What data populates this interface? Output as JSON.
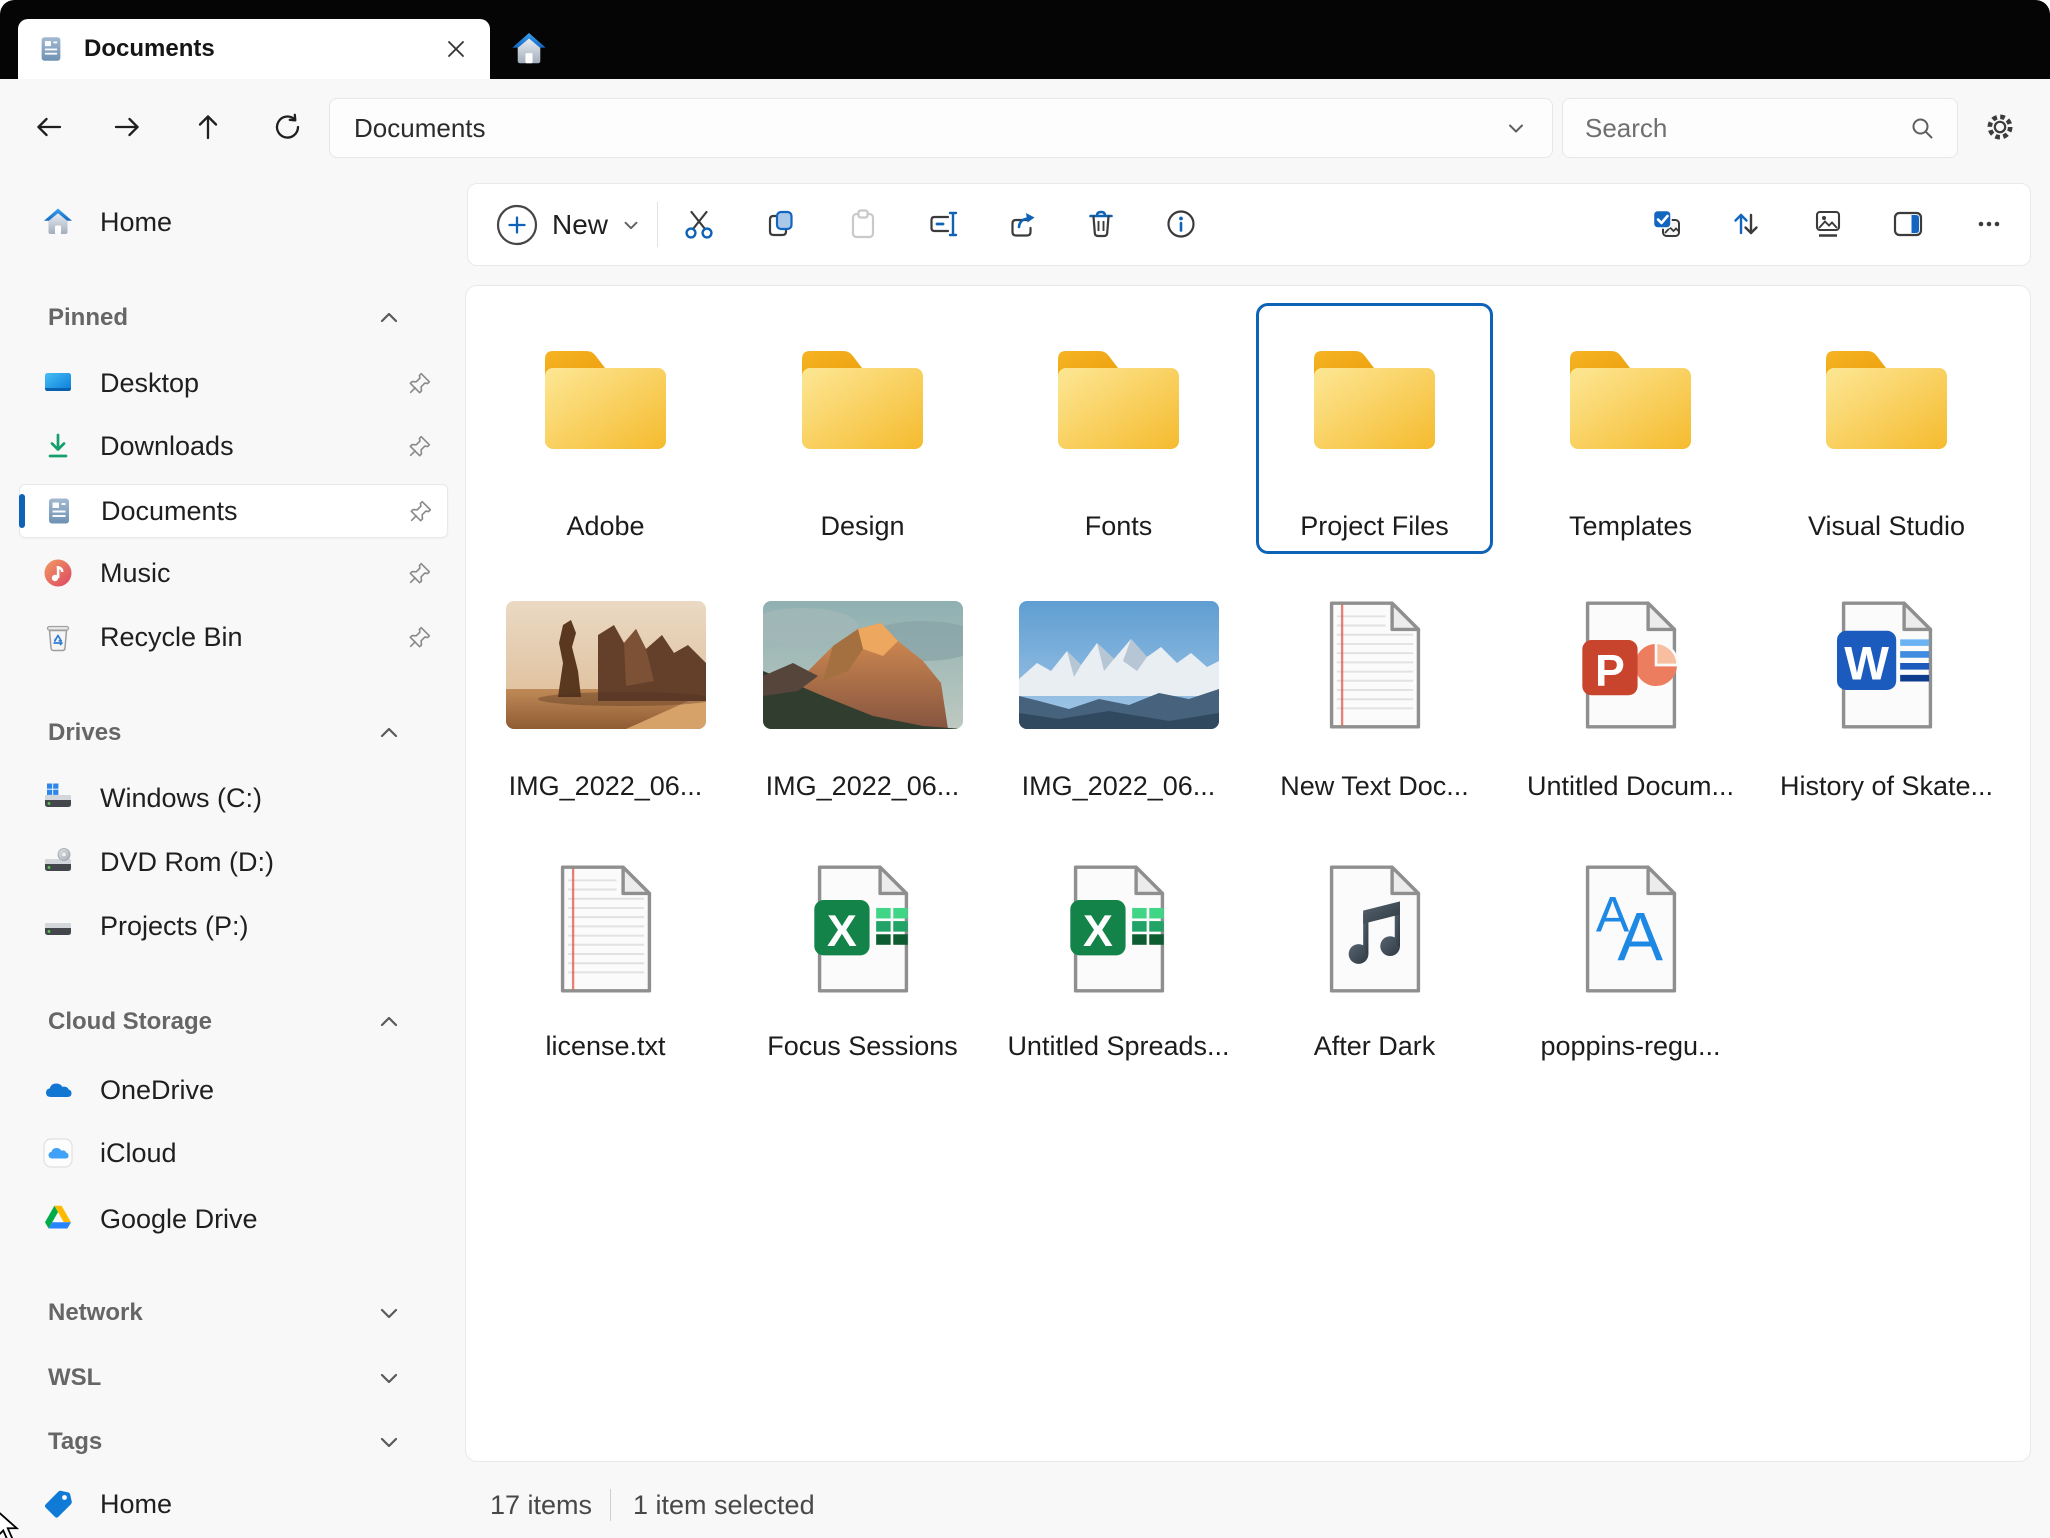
{
  "window": {
    "accent_color": "#0f63b6",
    "titlebar_color": "#050505",
    "background": "#f8f8f8"
  },
  "titlebar": {
    "tab_title": "Documents"
  },
  "toolbar": {
    "address_value": "Documents",
    "search_placeholder": "Search"
  },
  "command_bar": {
    "new_label": "New",
    "left_icons": [
      "cut",
      "copy",
      "paste",
      "rename",
      "share",
      "delete",
      "info"
    ],
    "right_icons": [
      "select-multiple",
      "sort",
      "view-thumbnails",
      "details-pane",
      "more"
    ]
  },
  "sidebar": {
    "home_label": "Home",
    "sections": [
      {
        "label": "Pinned",
        "state": "expanded",
        "items": [
          {
            "label": "Desktop",
            "icon": "desktop-icon",
            "pinned": true
          },
          {
            "label": "Downloads",
            "icon": "downloads-icon",
            "pinned": true
          },
          {
            "label": "Documents",
            "icon": "document-icon",
            "pinned": true,
            "selected": true
          },
          {
            "label": "Music",
            "icon": "music-icon",
            "pinned": true
          },
          {
            "label": "Recycle Bin",
            "icon": "recycle-bin-icon",
            "pinned": true
          }
        ]
      },
      {
        "label": "Drives",
        "state": "expanded",
        "items": [
          {
            "label": "Windows (C:)",
            "icon": "windows-drive-icon"
          },
          {
            "label": "DVD Rom (D:)",
            "icon": "dvd-drive-icon"
          },
          {
            "label": "Projects (P:)",
            "icon": "drive-icon"
          }
        ]
      },
      {
        "label": "Cloud Storage",
        "state": "expanded",
        "items": [
          {
            "label": "OneDrive",
            "icon": "onedrive-icon"
          },
          {
            "label": "iCloud",
            "icon": "icloud-icon"
          },
          {
            "label": "Google Drive",
            "icon": "google-drive-icon"
          }
        ]
      },
      {
        "label": "Network",
        "state": "collapsed",
        "items": []
      },
      {
        "label": "WSL",
        "state": "collapsed",
        "items": []
      },
      {
        "label": "Tags",
        "state": "collapsed",
        "items": [
          {
            "label": "Home",
            "icon": "tag-icon"
          }
        ]
      }
    ]
  },
  "content": {
    "tiles": [
      {
        "label": "Adobe",
        "type": "folder"
      },
      {
        "label": "Design",
        "type": "folder"
      },
      {
        "label": "Fonts",
        "type": "folder"
      },
      {
        "label": "Project Files",
        "type": "folder",
        "selected": true
      },
      {
        "label": "Templates",
        "type": "folder"
      },
      {
        "label": "Visual Studio",
        "type": "folder"
      },
      {
        "label": "IMG_2022_06...",
        "type": "image"
      },
      {
        "label": "IMG_2022_06...",
        "type": "image"
      },
      {
        "label": "IMG_2022_06...",
        "type": "image"
      },
      {
        "label": "New Text Doc...",
        "type": "text"
      },
      {
        "label": "Untitled Docum...",
        "type": "powerpoint"
      },
      {
        "label": "History of Skate...",
        "type": "word"
      },
      {
        "label": "license.txt",
        "type": "text"
      },
      {
        "label": "Focus Sessions",
        "type": "excel"
      },
      {
        "label": "Untitled Spreads...",
        "type": "excel"
      },
      {
        "label": "After Dark",
        "type": "audio"
      },
      {
        "label": "poppins-regu...",
        "type": "font"
      }
    ]
  },
  "statusbar": {
    "items_count": "17 items",
    "selection": "1 item selected"
  }
}
